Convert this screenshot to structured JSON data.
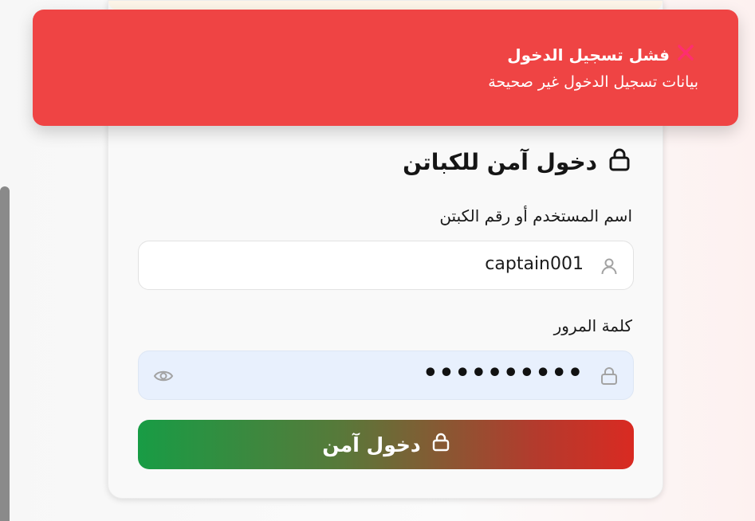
{
  "toast": {
    "title": "فشل تسجيل الدخول",
    "message": "بيانات تسجيل الدخول غير صحيحة",
    "icon": "close-x-icon",
    "color": "#ef4444"
  },
  "login": {
    "heading": "دخول آمن للكباتن",
    "heading_icon": "lock-icon",
    "username": {
      "label": "اسم المستخدم أو رقم الكبتن",
      "value": "captain001",
      "icon": "user-icon"
    },
    "password": {
      "label": "كلمة المرور",
      "value": "••••••••••",
      "icon": "lock-icon",
      "toggle_icon": "eye-icon"
    },
    "submit": {
      "label": "دخول آمن",
      "icon": "lock-icon",
      "gradient": [
        "#189c45",
        "#d92a22"
      ]
    }
  }
}
